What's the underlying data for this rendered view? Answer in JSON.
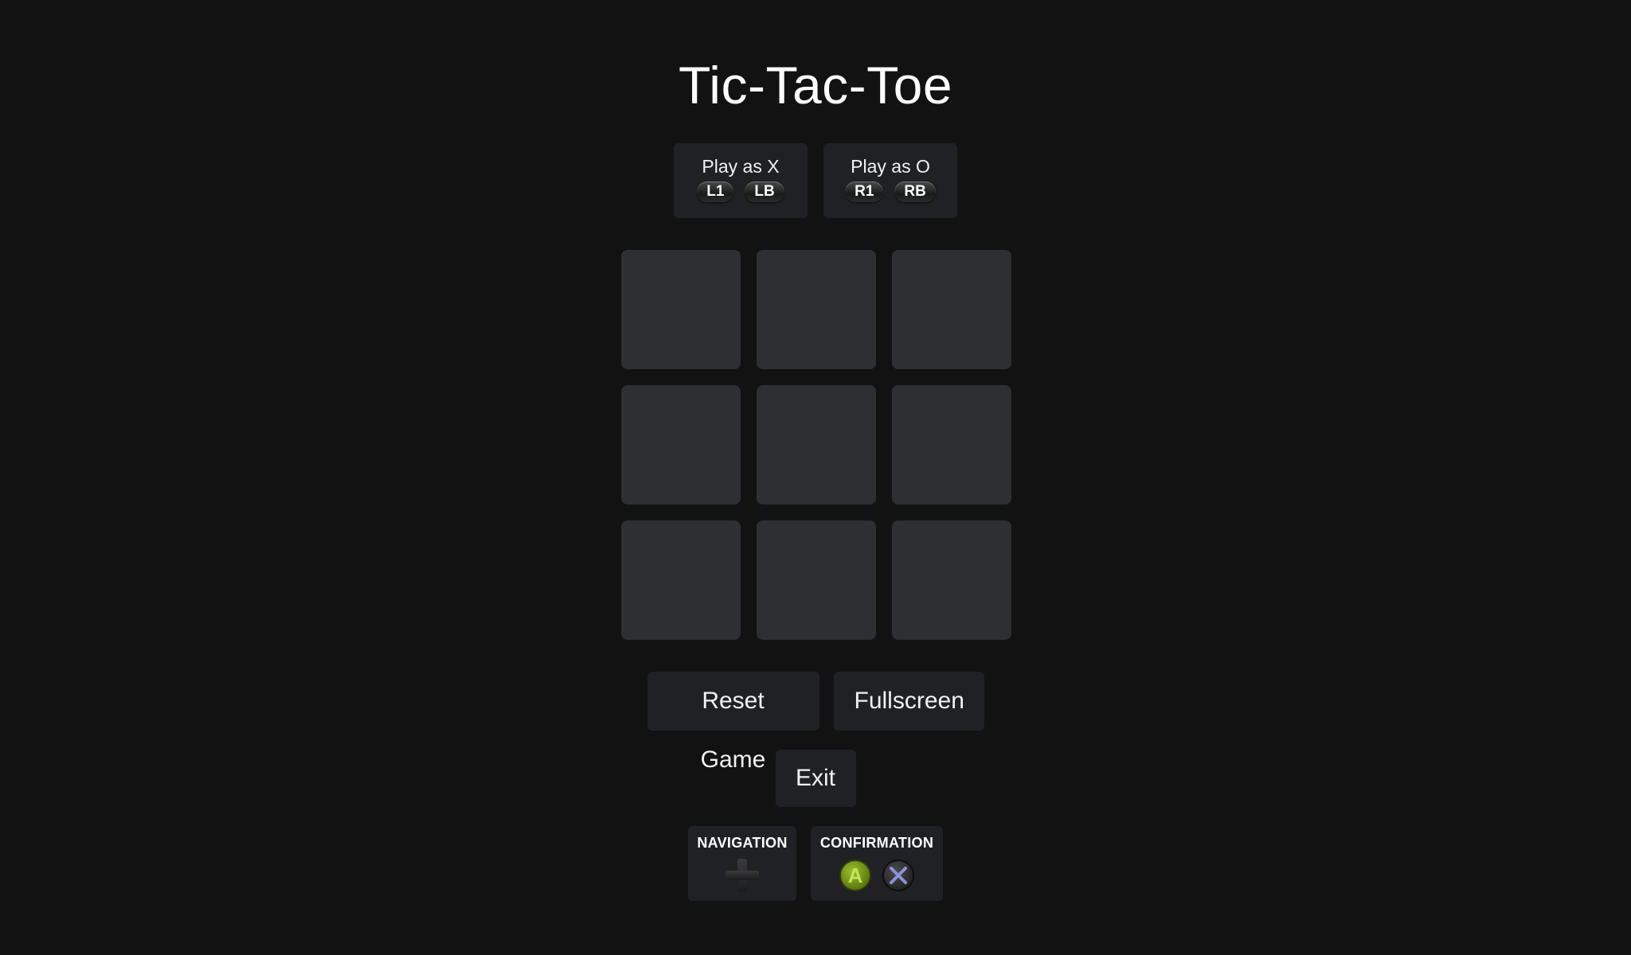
{
  "game": {
    "title": "Tic-Tac-Toe"
  },
  "players": [
    {
      "label": "Play as X",
      "badges": [
        "L1",
        "LB"
      ]
    },
    {
      "label": "Play as O",
      "badges": [
        "R1",
        "RB"
      ]
    }
  ],
  "board": {
    "cells": [
      "",
      "",
      "",
      "",
      "",
      "",
      "",
      "",
      ""
    ]
  },
  "actions": {
    "reset_label": "Reset Game",
    "fullscreen_label": "Fullscreen",
    "exit_label": "Exit"
  },
  "hints": {
    "navigation_title": "NAVIGATION",
    "navigation_icon": "dpad-icon",
    "confirmation_title": "CONFIRMATION",
    "confirm_icons": [
      {
        "name": "a-button-icon",
        "glyph": "A",
        "color": "#7fa31a"
      },
      {
        "name": "cross-button-icon",
        "glyph": "✕",
        "color": "#8a93d8"
      }
    ]
  }
}
